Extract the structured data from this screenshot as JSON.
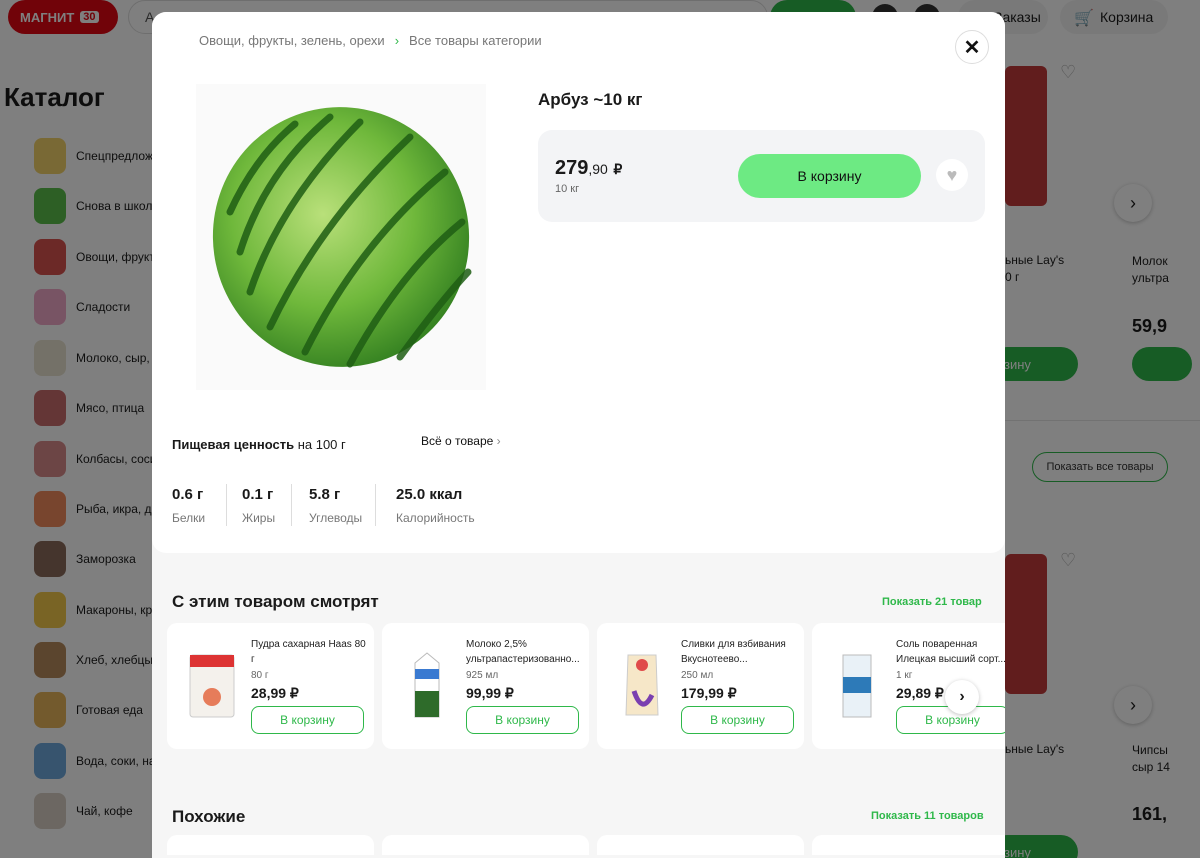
{
  "header": {
    "logo_text": "МАГНИТ",
    "logo_badge": "30",
    "search_text": "А",
    "orders_label": "Заказы",
    "cart_label": "Корзина"
  },
  "catalog": {
    "title": "Каталог",
    "items": [
      {
        "label": "Спецпредлож"
      },
      {
        "label": "Снова в школу"
      },
      {
        "label": "Овощи, фрукт"
      },
      {
        "label": "Сладости"
      },
      {
        "label": "Молоко, сыр, растительные"
      },
      {
        "label": "Мясо, птица"
      },
      {
        "label": "Колбасы, соси деликатесы"
      },
      {
        "label": "Рыба, икра, д"
      },
      {
        "label": "Заморозка"
      },
      {
        "label": "Макароны, кр"
      },
      {
        "label": "Хлеб, хлебцы,"
      },
      {
        "label": "Готовая еда"
      },
      {
        "label": "Вода, соки, на"
      },
      {
        "label": "Чай, кофе"
      }
    ]
  },
  "background_products": {
    "lays_top_name": "ьные Lay's",
    "lays_top_weight": "0 г",
    "milk_top_name": "Молок ультра",
    "milk_top_price": "59,9",
    "buy_partial": "зину",
    "show_all": "Показать все товары",
    "lays_bottom_name": "ьные Lay's",
    "chips_bottom_name": "Чипсы сыр 14",
    "chips_bottom_price": "161,",
    "buy_partial_bottom": "зину"
  },
  "modal": {
    "breadcrumb": [
      "Овощи, фрукты, зелень, орехи",
      "Все товары категории"
    ],
    "product_title": "Арбуз ~10 кг",
    "price_int": "279",
    "price_kop": ",90",
    "currency": "₽",
    "weight": "10 кг",
    "add_to_cart": "В корзину",
    "nutrition_title": "Пищевая ценность",
    "nutrition_per": " на 100 г",
    "all_about": "Всё о товаре",
    "nutrition": [
      {
        "value": "0.6 г",
        "label": "Белки"
      },
      {
        "value": "0.1 г",
        "label": "Жиры"
      },
      {
        "value": "5.8 г",
        "label": "Углеводы"
      },
      {
        "value": "25.0 ккал",
        "label": "Калорийность"
      }
    ],
    "related_title": "С этим товаром смотрят",
    "related_show": "Показать 21 товар",
    "related": [
      {
        "name": "Пудра сахарная Haas 80 г",
        "weight": "80 г",
        "price": "28,99 ₽",
        "btn": "В корзину"
      },
      {
        "name": "Молоко 2,5% ультрапастеризованно...",
        "weight": "925 мл",
        "price": "99,99 ₽",
        "btn": "В корзину"
      },
      {
        "name": "Сливки для взбивания Вкуснотеево...",
        "weight": "250 мл",
        "price": "179,99 ₽",
        "btn": "В корзину"
      },
      {
        "name": "Соль поваренная Илецкая высший сорт...",
        "weight": "1 кг",
        "price": "29,89 ₽",
        "btn": "В корзину"
      }
    ],
    "similar_title": "Похожие",
    "similar_show": "Показать 11 товаров"
  },
  "colors": {
    "brand_red": "#e30613",
    "accent_green": "#2fb84a",
    "cart_button": "#6dea83"
  }
}
